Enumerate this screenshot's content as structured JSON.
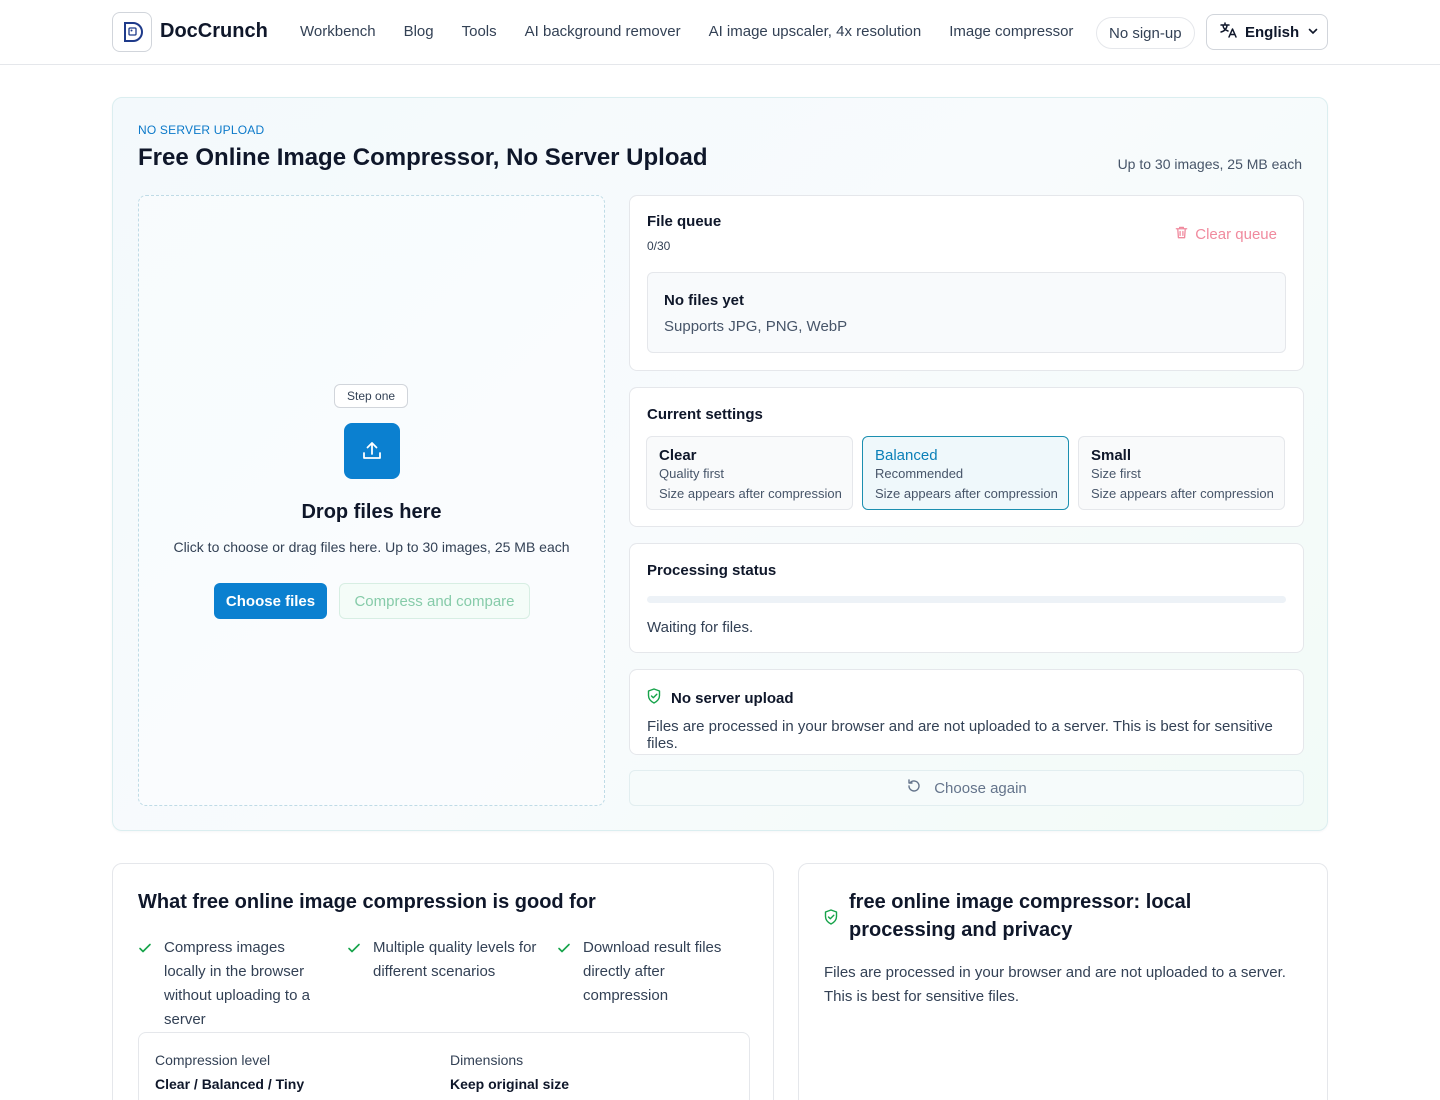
{
  "header": {
    "brand": "DocCrunch",
    "nav": [
      "Workbench",
      "Blog",
      "Tools",
      "AI background remover",
      "AI image upscaler, 4x resolution",
      "Image compressor"
    ],
    "no_signup": "No sign-up",
    "language": "English"
  },
  "hero": {
    "eyebrow": "NO SERVER UPLOAD",
    "title": "Free Online Image Compressor, No Server Upload",
    "limit": "Up to 30 images, 25 MB each"
  },
  "dropzone": {
    "step": "Step one",
    "title": "Drop files here",
    "subtitle": "Click to choose or drag files here. Up to 30 images, 25 MB each",
    "choose_label": "Choose files",
    "compress_label": "Compress and compare"
  },
  "queue": {
    "title": "File queue",
    "count": "0/30",
    "clear_label": "Clear queue",
    "empty_title": "No files yet",
    "empty_sub": "Supports JPG, PNG, WebP"
  },
  "settings": {
    "title": "Current settings",
    "options": [
      {
        "name": "Clear",
        "desc": "Quality first",
        "size": "Size appears after compression"
      },
      {
        "name": "Balanced",
        "desc": "Recommended",
        "size": "Size appears after compression"
      },
      {
        "name": "Small",
        "desc": "Size first",
        "size": "Size appears after compression"
      }
    ],
    "selected": "Balanced"
  },
  "status": {
    "title": "Processing status",
    "progress": 0,
    "message": "Waiting for files."
  },
  "privacy": {
    "title": "No server upload",
    "body": "Files are processed in your browser and are not uploaded to a server. This is best for sensitive files."
  },
  "choose_again": "Choose again",
  "benefits": {
    "title": "What free online image compression is good for",
    "items": [
      "Compress images locally in the browser without uploading to a server",
      "Multiple quality levels for different scenarios",
      "Download result files directly after compression"
    ],
    "specs": [
      {
        "label": "Compression level",
        "value": "Clear / Balanced / Tiny"
      },
      {
        "label": "Dimensions",
        "value": "Keep original size"
      }
    ]
  },
  "local": {
    "title": "free online image compressor: local processing and privacy",
    "body": "Files are processed in your browser and are not uploaded to a server. This is best for sensitive files."
  },
  "colors": {
    "accent": "#0b80d0",
    "success": "#16a34a",
    "danger_soft": "#f08a9e"
  },
  "icons": [
    "logo-icon",
    "translate-icon",
    "chevron-down-icon",
    "upload-icon",
    "trash-icon",
    "shield-check-icon",
    "refresh-icon",
    "check-icon"
  ]
}
